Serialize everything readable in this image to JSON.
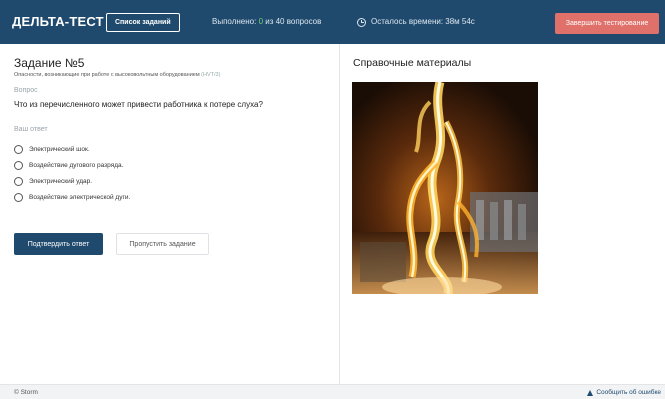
{
  "header": {
    "logo": "ДЕЛЬТА-ТЕСТ",
    "task_list_label": "Список заданий",
    "progress_prefix": "Выполнено:",
    "progress_done": "0",
    "progress_suffix": "из 40 вопросов",
    "timer_text": "Осталось времени: 38м 54с",
    "finish_label": "Завершить тестирование",
    "colors": {
      "background": "#1f4a6e",
      "finish": "#e0716a",
      "done": "#6fd36f"
    }
  },
  "task": {
    "title": "Задание №5",
    "subtitle": "Опасности, возникающие при работе с высоковольтным оборудованием",
    "code": "(HVT/3)",
    "question_label": "Вопрос",
    "question": "Что из перечисленного может привести работника к потере слуха?",
    "answer_label": "Ваш ответ",
    "options": [
      {
        "label": "Электрический шок."
      },
      {
        "label": "Воздействие дугового разряда."
      },
      {
        "label": "Электрический удар."
      },
      {
        "label": "Воздействие электрической дуги."
      }
    ],
    "submit_label": "Подтвердить ответ",
    "skip_label": "Пропустить задание"
  },
  "reference": {
    "title": "Справочные материалы",
    "image_icon": "electric-arc-photo"
  },
  "footer": {
    "copyright": "© Storm",
    "report_label": "Сообщить об ошибке"
  }
}
